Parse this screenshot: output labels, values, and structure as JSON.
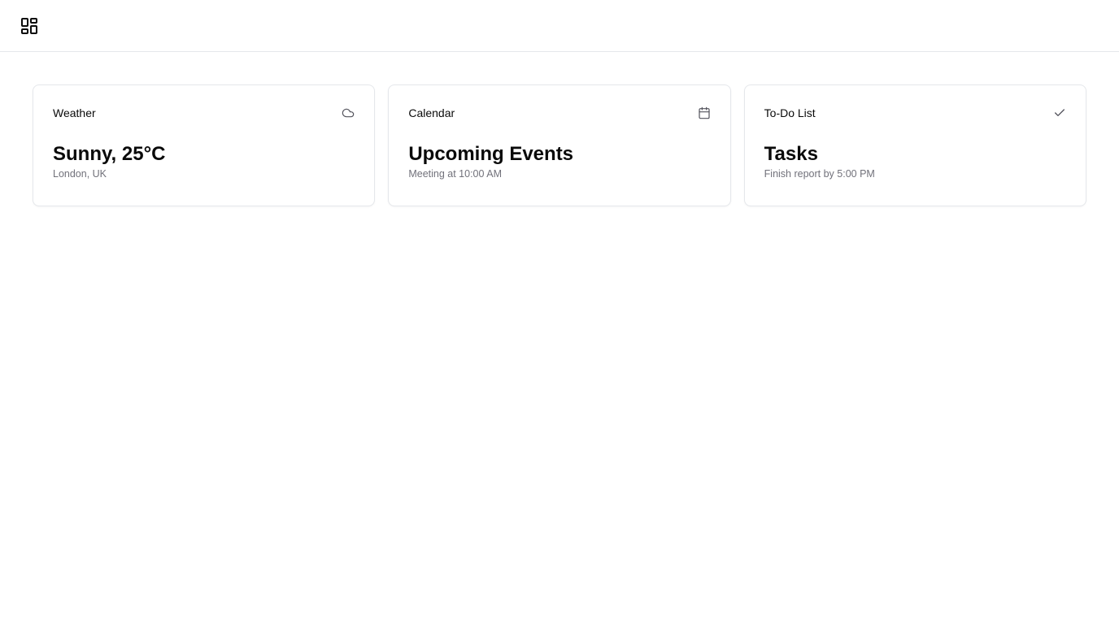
{
  "header": {
    "logo_icon": "dashboard-grid-icon"
  },
  "cards": [
    {
      "title": "Weather",
      "icon": "cloud-icon",
      "main": "Sunny, 25°C",
      "sub": "London, UK"
    },
    {
      "title": "Calendar",
      "icon": "calendar-icon",
      "main": "Upcoming Events",
      "sub": "Meeting at 10:00 AM"
    },
    {
      "title": "To-Do List",
      "icon": "check-icon",
      "main": "Tasks",
      "sub": "Finish report by 5:00 PM"
    }
  ]
}
